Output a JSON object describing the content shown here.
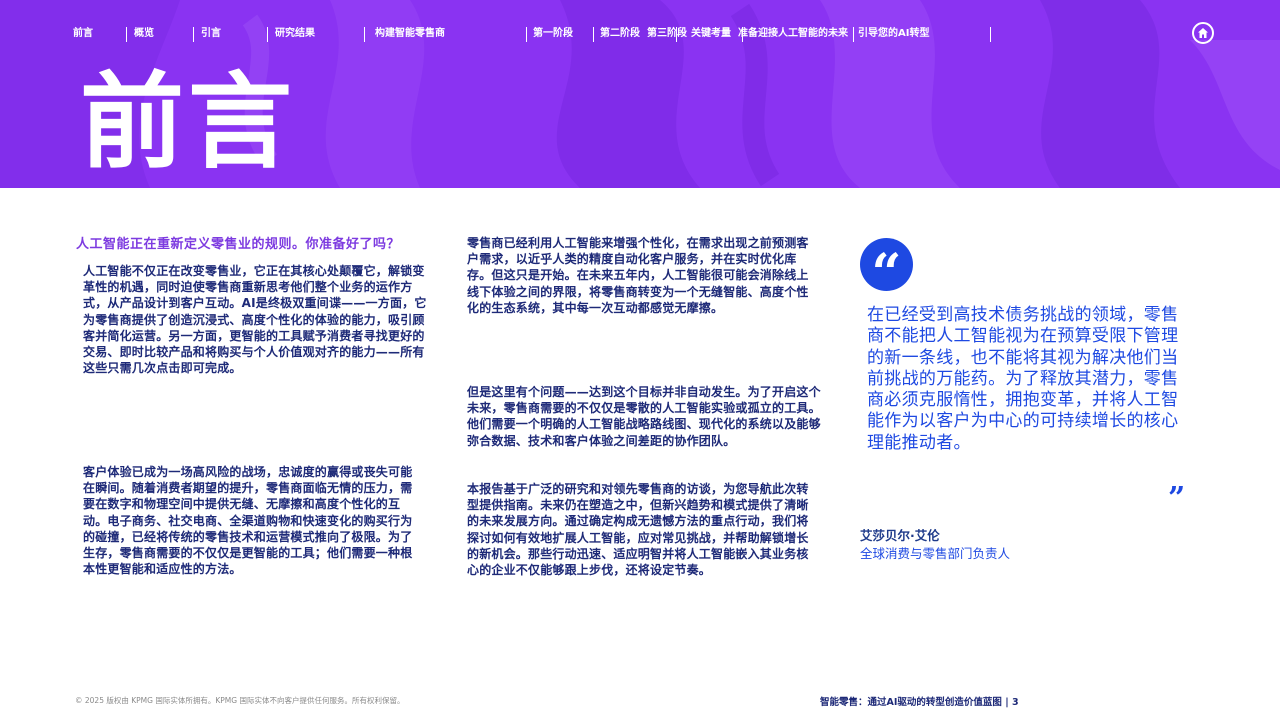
{
  "nav": {
    "items": [
      {
        "label": "前言"
      },
      {
        "label": "概览"
      },
      {
        "label": "引言"
      },
      {
        "label": "研究结果"
      },
      {
        "label": "构建智能零售商"
      },
      {
        "label": "第一阶段"
      },
      {
        "label": "第二阶段"
      },
      {
        "label": "第三阶段"
      },
      {
        "label": "关键考量"
      },
      {
        "label": "准备迎接人工智能的未来"
      },
      {
        "label": "引导您的AI转型"
      }
    ],
    "home_icon": "home-icon"
  },
  "header": {
    "title": "前言",
    "background_color": "#8a33f2"
  },
  "left_column": {
    "subheading": "人工智能正在重新定义零售业的规则。你准备好了吗？",
    "paragraph1": "人工智能不仅正在改变零售业，它正在其核心处颠覆它，解锁变革性的机遇，同时迫使零售商重新思考他们整个业务的运作方式，从产品设计到客户互动。AI是终极双重间谍——一方面，它为零售商提供了创造沉浸式、高度个性化的体验的能力，吸引顾客并简化运营。另一方面，更智能的工具赋予消费者寻找更好的交易、即时比较产品和将购买与个人价值观对齐的能力——所有这些只需几次点击即可完成。",
    "paragraph2": "客户体验已成为一场高风险的战场，忠诚度的赢得或丧失可能在瞬间。随着消费者期望的提升，零售商面临无情的压力，需要在数字和物理空间中提供无缝、无摩擦和高度个性化的互动。电子商务、社交电商、全渠道购物和快速变化的购买行为的碰撞，已经将传统的零售技术和运营模式推向了极限。为了生存，零售商需要的不仅仅是更智能的工具；他们需要一种根本性更智能和适应性的方法。"
  },
  "middle_column": {
    "paragraph1": "零售商已经利用人工智能来增强个性化，在需求出现之前预测客户需求，以近乎人类的精度自动化客户服务，并在实时优化库存。但这只是开始。在未来五年内，人工智能很可能会消除线上线下体验之间的界限，将零售商转变为一个无缝智能、高度个性化的生态系统，其中每一次互动都感觉无摩擦。",
    "paragraph2": "但是这里有个问题——达到这个目标并非自动发生。为了开启这个未来，零售商需要的不仅仅是零散的人工智能实验或孤立的工具。他们需要一个明确的人工智能战略路线图、现代化的系统以及能够弥合数据、技术和客户体验之间差距的协作团队。",
    "paragraph3": "本报告基于广泛的研究和对领先零售商的访谈，为您导航此次转型提供指南。未来仍在塑造之中，但新兴趋势和模式提供了清晰的未来发展方向。通过确定构成无遗憾方法的重点行动，我们将探讨如何有效地扩展人工智能，应对常见挑战，并帮助解锁增长的新机会。那些行动迅速、适应明智并将人工智能嵌入其业务核心的企业不仅能够跟上步伐，还将设定节奏。"
  },
  "quote": {
    "open_mark": "“",
    "text": "在已经受到高技术债务挑战的领域，零售商不能把人工智能视为在预算受限下管理的新一条线，也不能将其视为解决他们当前挑战的万能药。为了释放其潜力，零售商必须克服惰性，拥抱变革，并将人工智能作为以客户为中心的可持续增长的核心理能推动者。",
    "close_mark": "”",
    "author_name": "艾莎贝尔·艾伦",
    "author_role": "全球消费与零售部门负责人",
    "accent_color": "#1e49e2"
  },
  "footer": {
    "copyright": "© 2025 版权由 KPMG 国际实体所拥有。KPMG 国际实体不向客户提供任何服务。所有权利保留。",
    "doc_title": "智能零售：通过AI驱动的转型创造价值蓝图 | 3"
  }
}
